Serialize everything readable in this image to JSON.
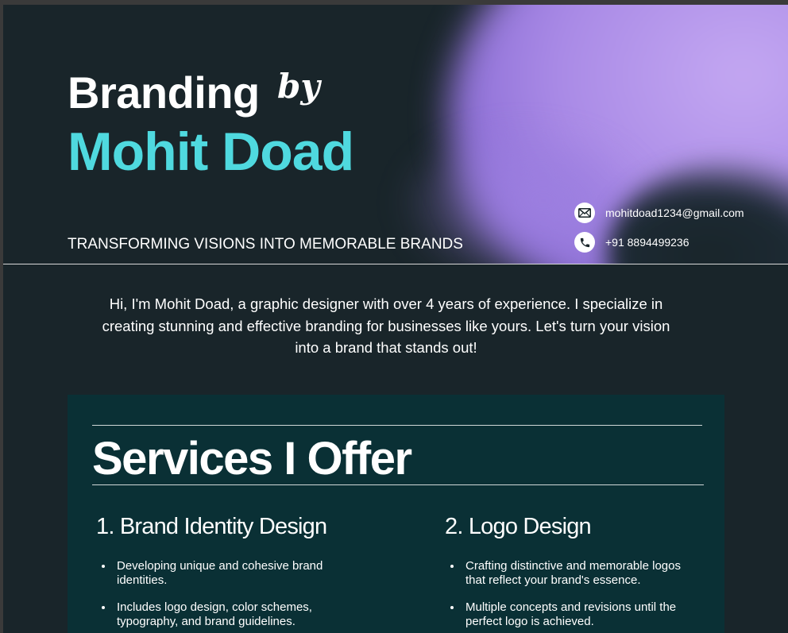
{
  "header": {
    "title_line1": "Branding",
    "title_by": "by",
    "title_line2": "Mohit Doad",
    "tagline": "TRANSFORMING VISIONS INTO MEMORABLE BRANDS",
    "email": "mohitdoad1234@gmail.com",
    "phone": "+91 8894499236",
    "email_icon": "envelope-icon",
    "phone_icon": "phone-icon"
  },
  "intro": {
    "text": "Hi, I'm Mohit Doad, a graphic designer with over 4 years of experience. I specialize in creating stunning and effective branding for businesses like yours. Let's turn your vision into a brand that stands out!"
  },
  "services": {
    "title": "Services I Offer",
    "items": [
      {
        "heading": "1. Brand Identity Design",
        "bullets": [
          "Developing unique and cohesive brand identities.",
          "Includes logo design, color schemes, typography, and brand guidelines."
        ]
      },
      {
        "heading": "2. Logo Design",
        "bullets": [
          "Crafting distinctive and memorable logos that reflect your brand's essence.",
          "Multiple concepts and revisions until the perfect logo is achieved."
        ]
      }
    ]
  },
  "colors": {
    "background": "#19252a",
    "accent": "#4fd9df",
    "services_panel": "#0a3035",
    "gradient": "#a98ae6"
  }
}
